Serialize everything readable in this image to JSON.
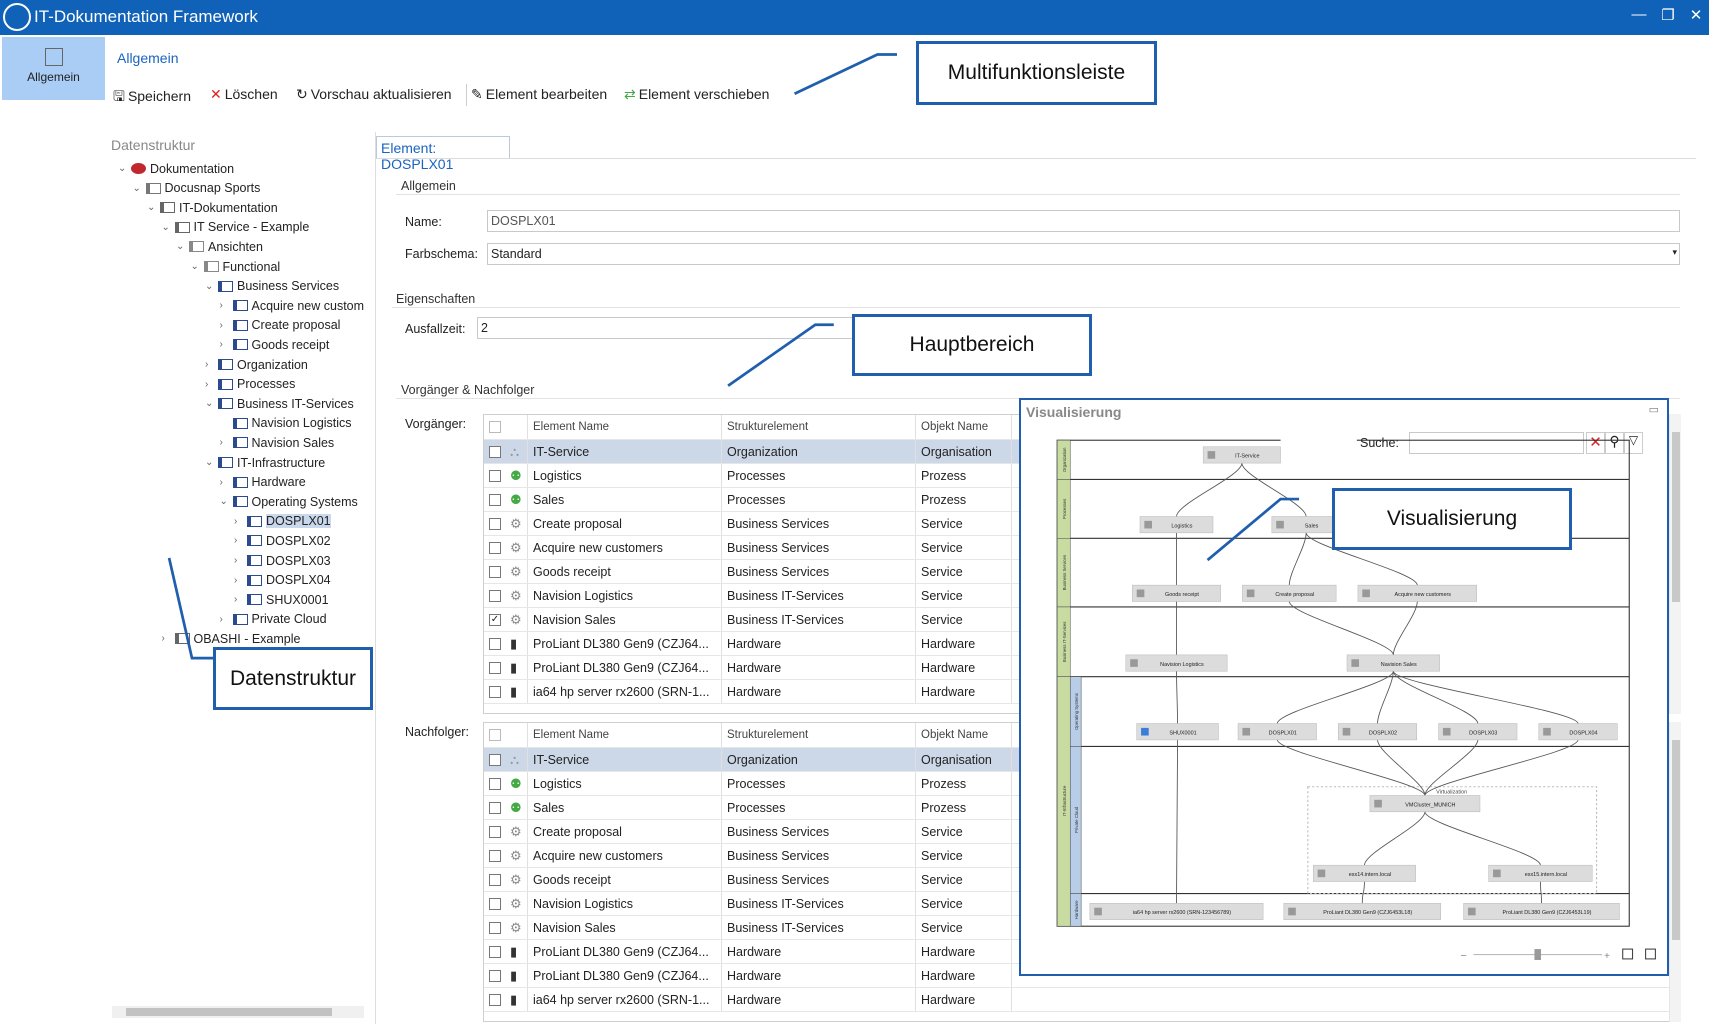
{
  "app": {
    "title": "IT-Dokumentation Framework"
  },
  "window_controls": {
    "minimize": "—",
    "maximize": "❐",
    "close": "✕"
  },
  "nav": {
    "allgemein": "Allgemein"
  },
  "ribbon": {
    "title": "Allgemein",
    "save": "Speichern",
    "delete": "Löschen",
    "refresh": "Vorschau aktualisieren",
    "edit": "Element bearbeiten",
    "move": "Element verschieben"
  },
  "tree": {
    "title": "Datenstruktur",
    "items": [
      {
        "label": "Dokumentation",
        "depth": 0,
        "state": "expanded",
        "icon": "docusnap-logo"
      },
      {
        "label": "Docusnap Sports",
        "depth": 1,
        "state": "expanded",
        "icon": "building"
      },
      {
        "label": "IT-Dokumentation",
        "depth": 2,
        "state": "expanded",
        "icon": "hierarchy"
      },
      {
        "label": "IT Service - Example",
        "depth": 3,
        "state": "expanded",
        "icon": "hierarchy"
      },
      {
        "label": "Ansichten",
        "depth": 4,
        "state": "expanded",
        "icon": "views"
      },
      {
        "label": "Functional",
        "depth": 5,
        "state": "expanded",
        "icon": "views"
      },
      {
        "label": "Business Services",
        "depth": 6,
        "state": "expanded",
        "icon": "layer"
      },
      {
        "label": "Acquire new custom",
        "depth": 7,
        "state": "collapsed",
        "icon": "element"
      },
      {
        "label": "Create proposal",
        "depth": 7,
        "state": "collapsed",
        "icon": "element"
      },
      {
        "label": "Goods receipt",
        "depth": 7,
        "state": "collapsed",
        "icon": "element"
      },
      {
        "label": "Organization",
        "depth": 6,
        "state": "collapsed",
        "icon": "layer"
      },
      {
        "label": "Processes",
        "depth": 6,
        "state": "collapsed",
        "icon": "layer"
      },
      {
        "label": "Business IT-Services",
        "depth": 6,
        "state": "expanded",
        "icon": "layer"
      },
      {
        "label": "Navision Logistics",
        "depth": 7,
        "state": "leaf",
        "icon": "element"
      },
      {
        "label": "Navision Sales",
        "depth": 7,
        "state": "collapsed",
        "icon": "element"
      },
      {
        "label": "IT-Infrastructure",
        "depth": 6,
        "state": "expanded",
        "icon": "layer"
      },
      {
        "label": "Hardware",
        "depth": 7,
        "state": "collapsed",
        "icon": "layer"
      },
      {
        "label": "Operating Systems",
        "depth": 7,
        "state": "expanded",
        "icon": "layer"
      },
      {
        "label": "DOSPLX01",
        "depth": 8,
        "state": "collapsed",
        "icon": "element",
        "selected": true
      },
      {
        "label": "DOSPLX02",
        "depth": 8,
        "state": "collapsed",
        "icon": "element"
      },
      {
        "label": "DOSPLX03",
        "depth": 8,
        "state": "collapsed",
        "icon": "element"
      },
      {
        "label": "DOSPLX04",
        "depth": 8,
        "state": "collapsed",
        "icon": "element"
      },
      {
        "label": "SHUX0001",
        "depth": 8,
        "state": "collapsed",
        "icon": "element"
      },
      {
        "label": "Private Cloud",
        "depth": 7,
        "state": "collapsed",
        "icon": "layer"
      },
      {
        "label": "OBASHI - Example",
        "depth": 3,
        "state": "collapsed",
        "icon": "hierarchy"
      }
    ]
  },
  "main": {
    "tab": "Element: DOSPLX01",
    "general": "Allgemein",
    "name_label": "Name:",
    "name_value": "DOSPLX01",
    "scheme_label": "Farbschema:",
    "scheme_value": "Standard",
    "props": "Eigenschaften",
    "downtime_label": "Ausfallzeit:",
    "downtime_value": "2",
    "relations": "Vorgänger & Nachfolger",
    "pred_label": "Vorgänger:",
    "succ_label": "Nachfolger:",
    "columns": [
      "Element Name",
      "Strukturelement",
      "Objekt Name"
    ],
    "rows": [
      {
        "icon": "organization",
        "name": "IT-Service",
        "struct": "Organization",
        "obj": "Organisation"
      },
      {
        "icon": "process",
        "name": "Logistics",
        "struct": "Processes",
        "obj": "Prozess"
      },
      {
        "icon": "process",
        "name": "Sales",
        "struct": "Processes",
        "obj": "Prozess"
      },
      {
        "icon": "gear",
        "name": "Create proposal",
        "struct": "Business Services",
        "obj": "Service"
      },
      {
        "icon": "gear",
        "name": "Acquire new customers",
        "struct": "Business Services",
        "obj": "Service"
      },
      {
        "icon": "gear",
        "name": "Goods receipt",
        "struct": "Business Services",
        "obj": "Service"
      },
      {
        "icon": "gear",
        "name": "Navision Logistics",
        "struct": "Business IT-Services",
        "obj": "Service"
      },
      {
        "icon": "gear",
        "name": "Navision Sales",
        "struct": "Business IT-Services",
        "obj": "Service"
      },
      {
        "icon": "server",
        "name": "ProLiant DL380 Gen9 (CZJ64...",
        "struct": "Hardware",
        "obj": "Hardware"
      },
      {
        "icon": "server",
        "name": "ProLiant DL380 Gen9 (CZJ64...",
        "struct": "Hardware",
        "obj": "Hardware"
      },
      {
        "icon": "server",
        "name": "ia64 hp server rx2600 (SRN-1...",
        "struct": "Hardware",
        "obj": "Hardware"
      }
    ],
    "pred_checked": [
      7
    ],
    "highlight_row": 0
  },
  "vis": {
    "title": "Visualisierung",
    "search_label": "Suche:",
    "search_value": "",
    "group_label": "Virtualization",
    "lanes": [
      "Organization",
      "Processes",
      "Business Services",
      "Business IT-Services",
      "Operating Systems",
      "Private Cloud",
      "Hardware"
    ],
    "super_lane": "IT-Infrastructure",
    "nodes": [
      "IT-Service",
      "Logistics",
      "Sales",
      "Goods receipt",
      "Create proposal",
      "Acquire new customers",
      "Navision Logistics",
      "Navision Sales",
      "SHUX0001",
      "DOSPLX01",
      "DOSPLX02",
      "DOSPLX03",
      "DOSPLX04",
      "VMCluster_MUNICH",
      "esx14.intern.local",
      "esx15.intern.local",
      "ia64 hp server rx2600 (SRN-123456789)",
      "ProLiant DL380 Gen9 (CZJ6453L18)",
      "ProLiant DL380 Gen9 (CZJ6453L19)"
    ],
    "edges": [
      [
        0,
        1
      ],
      [
        0,
        2
      ],
      [
        1,
        3
      ],
      [
        2,
        4
      ],
      [
        2,
        5
      ],
      [
        3,
        6
      ],
      [
        4,
        7
      ],
      [
        5,
        7
      ],
      [
        6,
        8
      ],
      [
        7,
        9
      ],
      [
        7,
        10
      ],
      [
        7,
        11
      ],
      [
        7,
        12
      ],
      [
        9,
        13
      ],
      [
        10,
        13
      ],
      [
        11,
        13
      ],
      [
        12,
        13
      ],
      [
        13,
        14
      ],
      [
        13,
        15
      ],
      [
        8,
        16
      ],
      [
        14,
        17
      ],
      [
        15,
        18
      ]
    ],
    "zoom_level": 0.5
  },
  "callouts": {
    "ribbon": "Multifunktionsleiste",
    "main": "Hauptbereich",
    "vis": "Visualisierung",
    "tree": "Datenstruktur"
  },
  "colors": {
    "titlebar": "#0f62b7",
    "accent": "#1a63c0",
    "callout_border": "#1f5fae",
    "selection": "#ccd8e8"
  }
}
